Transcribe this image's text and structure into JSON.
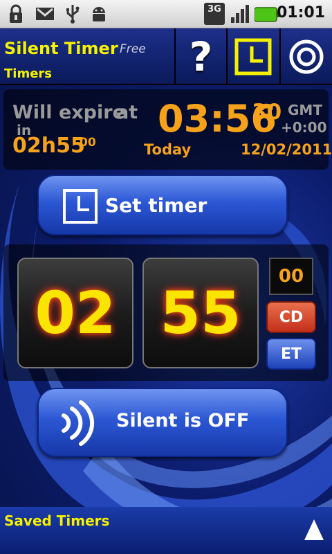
{
  "status_bar": {
    "time": "01:01",
    "network": "3G",
    "icons": [
      "lock-icon",
      "gmail-icon",
      "usb-icon",
      "android-debug-icon",
      "network-3g-icon",
      "signal-icon",
      "battery-icon"
    ]
  },
  "header": {
    "title": "Silent Timer",
    "edition": "Free",
    "subtitle": "Timers",
    "buttons": [
      "help-icon",
      "clock-icon",
      "settings-icon"
    ],
    "help_label": "?"
  },
  "expire": {
    "will_expire": "Will expire",
    "at_label": "at",
    "in_label": "in",
    "remaining_hm": "02h55",
    "remaining_s": "00",
    "time": "03:56",
    "seconds": "30",
    "gmt": "GMT",
    "offset": "+0:00",
    "day": "Today",
    "date": "12/02/2011"
  },
  "set_timer": {
    "label": "Set timer"
  },
  "timer": {
    "hours": "02",
    "minutes": "55",
    "seconds": "00",
    "cd_label": "CD",
    "et_label": "ET"
  },
  "silent": {
    "label": "Silent is OFF"
  },
  "footer": {
    "label": "Saved Timers"
  },
  "colors": {
    "accent_yellow": "#f5f200",
    "accent_orange": "#f7a21b",
    "cd_red": "#d13b1d",
    "et_blue": "#1f4fd0"
  }
}
